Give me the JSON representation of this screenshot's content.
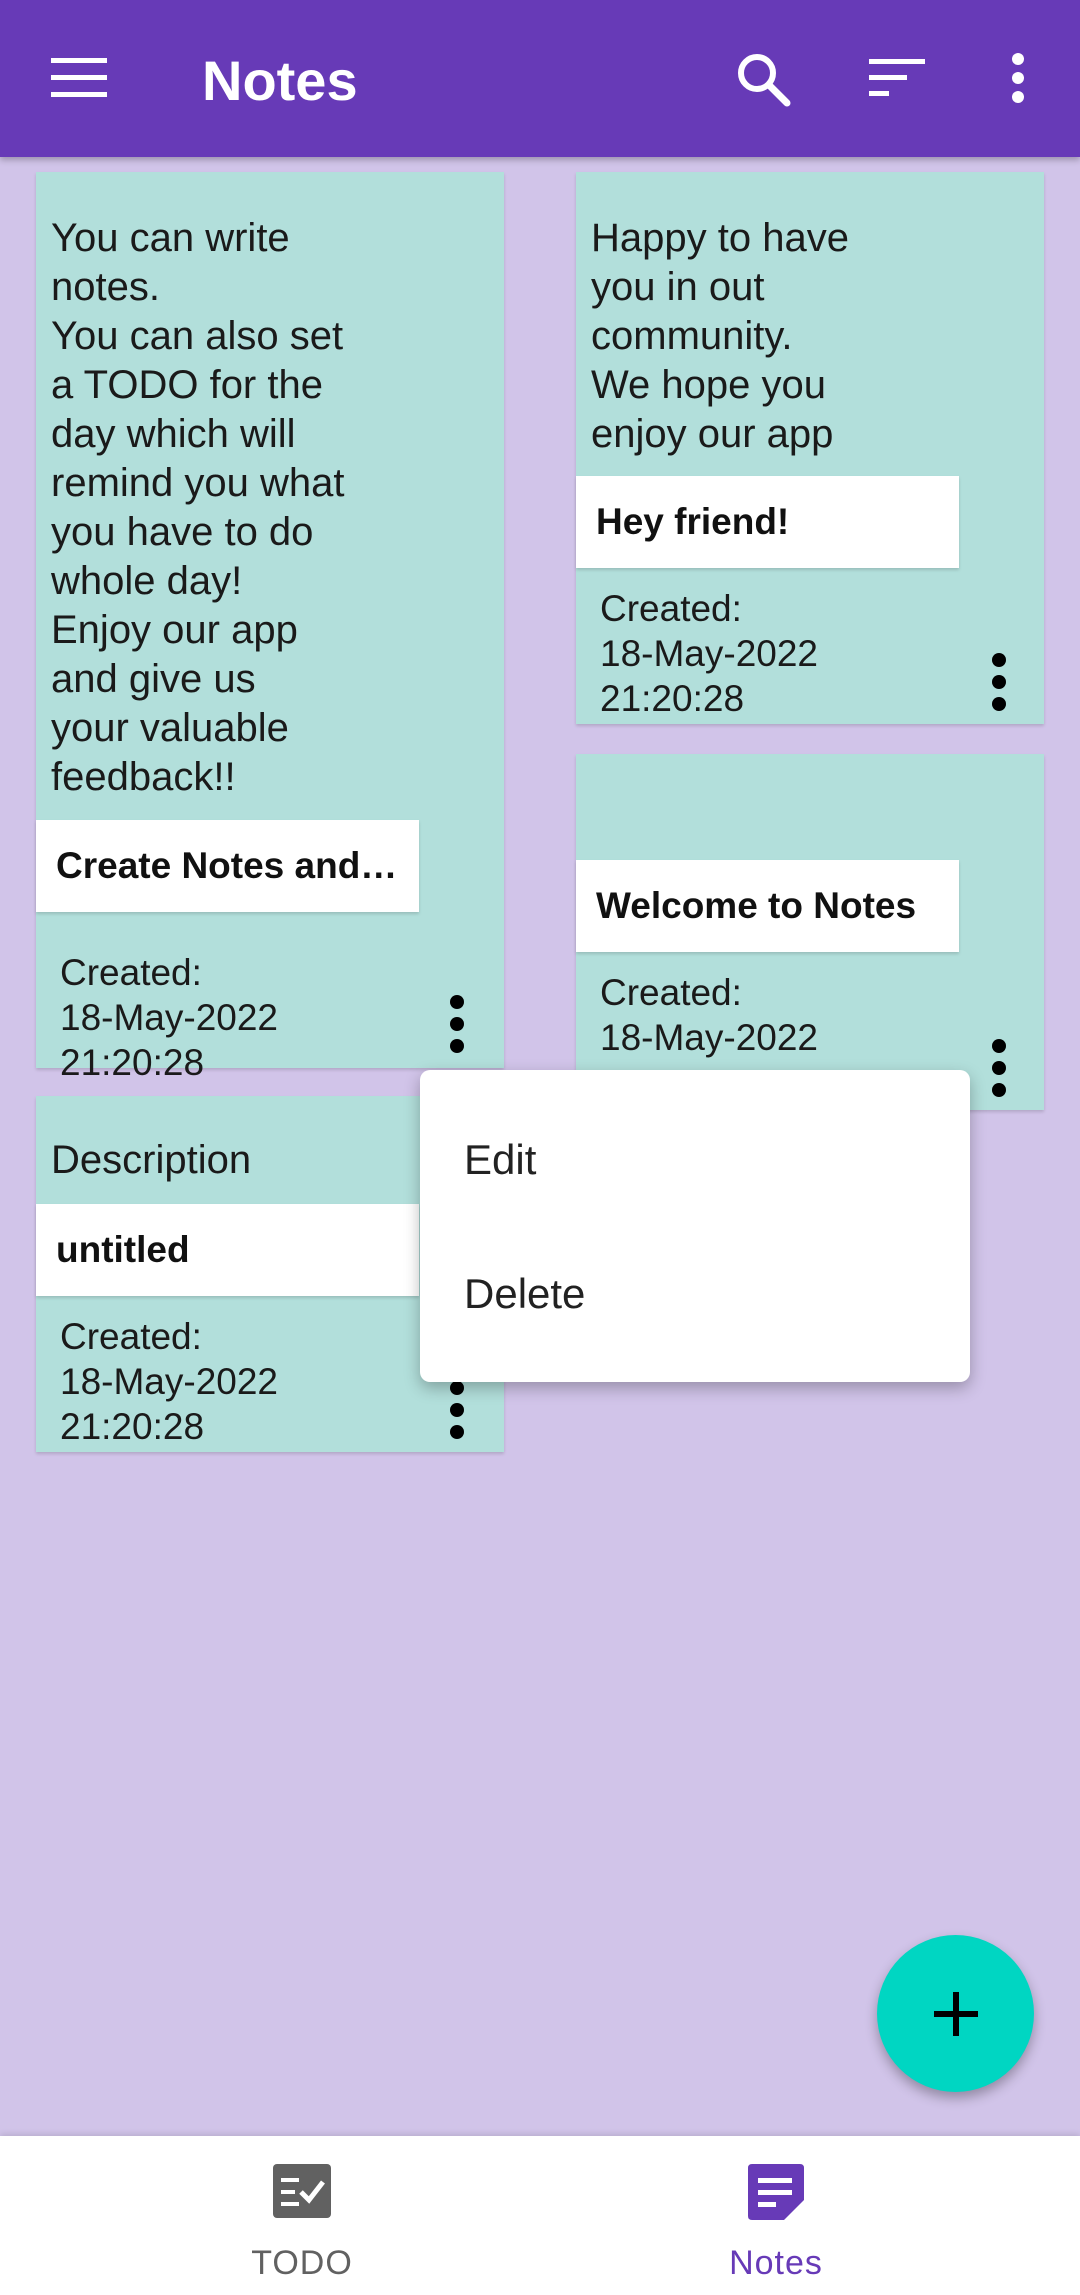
{
  "appbar": {
    "title": "Notes",
    "icons": [
      "menu-icon",
      "search-icon",
      "sort-icon",
      "overflow-menu-icon"
    ]
  },
  "notes": [
    {
      "description": "You can write\nnotes.\nYou can also set\na TODO for the\nday which will\nremind you what\nyou have to do\nwhole day!\n Enjoy our app\nand give us\nyour valuable\nfeedback!!",
      "title": "Create Notes and…",
      "created_label": "Created:",
      "created_date": "18-May-2022",
      "created_time": "21:20:28"
    },
    {
      "description": "Happy to have\nyou in out\ncommunity.\nWe hope you\nenjoy our app",
      "title": "Hey friend!",
      "created_label": "Created:",
      "created_date": "18-May-2022",
      "created_time": "21:20:28"
    },
    {
      "description": "",
      "title": "Welcome to Notes",
      "created_label": "Created:",
      "created_date": "18-May-2022",
      "created_time": ""
    },
    {
      "description": "Description",
      "title": "untitled",
      "created_label": "Created:",
      "created_date": "18-May-2022",
      "created_time": "21:20:28"
    }
  ],
  "context_menu": {
    "items": [
      "Edit",
      "Delete"
    ]
  },
  "fab": {
    "icon": "plus-icon"
  },
  "bottom_nav": {
    "items": [
      {
        "label": "TODO",
        "icon": "todo-checklist-icon",
        "selected": false
      },
      {
        "label": "Notes",
        "icon": "notes-icon",
        "selected": true
      }
    ]
  },
  "colors": {
    "primary": "#673ab7",
    "background": "#d1c4e9",
    "card": "#b2dfdb",
    "fab": "#00d6c2",
    "nav_selected": "#673ab7",
    "nav_unselected": "#616161"
  }
}
